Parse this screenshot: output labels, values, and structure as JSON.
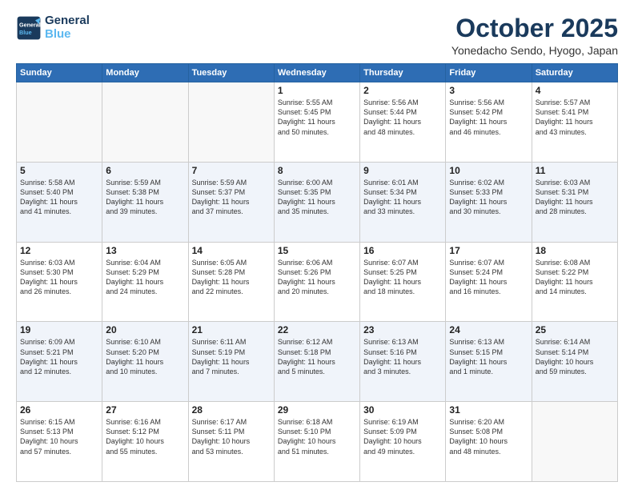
{
  "logo": {
    "line1": "General",
    "line2": "Blue"
  },
  "title": "October 2025",
  "subtitle": "Yonedacho Sendo, Hyogo, Japan",
  "weekdays": [
    "Sunday",
    "Monday",
    "Tuesday",
    "Wednesday",
    "Thursday",
    "Friday",
    "Saturday"
  ],
  "weeks": [
    [
      {
        "day": "",
        "info": ""
      },
      {
        "day": "",
        "info": ""
      },
      {
        "day": "",
        "info": ""
      },
      {
        "day": "1",
        "info": "Sunrise: 5:55 AM\nSunset: 5:45 PM\nDaylight: 11 hours\nand 50 minutes."
      },
      {
        "day": "2",
        "info": "Sunrise: 5:56 AM\nSunset: 5:44 PM\nDaylight: 11 hours\nand 48 minutes."
      },
      {
        "day": "3",
        "info": "Sunrise: 5:56 AM\nSunset: 5:42 PM\nDaylight: 11 hours\nand 46 minutes."
      },
      {
        "day": "4",
        "info": "Sunrise: 5:57 AM\nSunset: 5:41 PM\nDaylight: 11 hours\nand 43 minutes."
      }
    ],
    [
      {
        "day": "5",
        "info": "Sunrise: 5:58 AM\nSunset: 5:40 PM\nDaylight: 11 hours\nand 41 minutes."
      },
      {
        "day": "6",
        "info": "Sunrise: 5:59 AM\nSunset: 5:38 PM\nDaylight: 11 hours\nand 39 minutes."
      },
      {
        "day": "7",
        "info": "Sunrise: 5:59 AM\nSunset: 5:37 PM\nDaylight: 11 hours\nand 37 minutes."
      },
      {
        "day": "8",
        "info": "Sunrise: 6:00 AM\nSunset: 5:35 PM\nDaylight: 11 hours\nand 35 minutes."
      },
      {
        "day": "9",
        "info": "Sunrise: 6:01 AM\nSunset: 5:34 PM\nDaylight: 11 hours\nand 33 minutes."
      },
      {
        "day": "10",
        "info": "Sunrise: 6:02 AM\nSunset: 5:33 PM\nDaylight: 11 hours\nand 30 minutes."
      },
      {
        "day": "11",
        "info": "Sunrise: 6:03 AM\nSunset: 5:31 PM\nDaylight: 11 hours\nand 28 minutes."
      }
    ],
    [
      {
        "day": "12",
        "info": "Sunrise: 6:03 AM\nSunset: 5:30 PM\nDaylight: 11 hours\nand 26 minutes."
      },
      {
        "day": "13",
        "info": "Sunrise: 6:04 AM\nSunset: 5:29 PM\nDaylight: 11 hours\nand 24 minutes."
      },
      {
        "day": "14",
        "info": "Sunrise: 6:05 AM\nSunset: 5:28 PM\nDaylight: 11 hours\nand 22 minutes."
      },
      {
        "day": "15",
        "info": "Sunrise: 6:06 AM\nSunset: 5:26 PM\nDaylight: 11 hours\nand 20 minutes."
      },
      {
        "day": "16",
        "info": "Sunrise: 6:07 AM\nSunset: 5:25 PM\nDaylight: 11 hours\nand 18 minutes."
      },
      {
        "day": "17",
        "info": "Sunrise: 6:07 AM\nSunset: 5:24 PM\nDaylight: 11 hours\nand 16 minutes."
      },
      {
        "day": "18",
        "info": "Sunrise: 6:08 AM\nSunset: 5:22 PM\nDaylight: 11 hours\nand 14 minutes."
      }
    ],
    [
      {
        "day": "19",
        "info": "Sunrise: 6:09 AM\nSunset: 5:21 PM\nDaylight: 11 hours\nand 12 minutes."
      },
      {
        "day": "20",
        "info": "Sunrise: 6:10 AM\nSunset: 5:20 PM\nDaylight: 11 hours\nand 10 minutes."
      },
      {
        "day": "21",
        "info": "Sunrise: 6:11 AM\nSunset: 5:19 PM\nDaylight: 11 hours\nand 7 minutes."
      },
      {
        "day": "22",
        "info": "Sunrise: 6:12 AM\nSunset: 5:18 PM\nDaylight: 11 hours\nand 5 minutes."
      },
      {
        "day": "23",
        "info": "Sunrise: 6:13 AM\nSunset: 5:16 PM\nDaylight: 11 hours\nand 3 minutes."
      },
      {
        "day": "24",
        "info": "Sunrise: 6:13 AM\nSunset: 5:15 PM\nDaylight: 11 hours\nand 1 minute."
      },
      {
        "day": "25",
        "info": "Sunrise: 6:14 AM\nSunset: 5:14 PM\nDaylight: 10 hours\nand 59 minutes."
      }
    ],
    [
      {
        "day": "26",
        "info": "Sunrise: 6:15 AM\nSunset: 5:13 PM\nDaylight: 10 hours\nand 57 minutes."
      },
      {
        "day": "27",
        "info": "Sunrise: 6:16 AM\nSunset: 5:12 PM\nDaylight: 10 hours\nand 55 minutes."
      },
      {
        "day": "28",
        "info": "Sunrise: 6:17 AM\nSunset: 5:11 PM\nDaylight: 10 hours\nand 53 minutes."
      },
      {
        "day": "29",
        "info": "Sunrise: 6:18 AM\nSunset: 5:10 PM\nDaylight: 10 hours\nand 51 minutes."
      },
      {
        "day": "30",
        "info": "Sunrise: 6:19 AM\nSunset: 5:09 PM\nDaylight: 10 hours\nand 49 minutes."
      },
      {
        "day": "31",
        "info": "Sunrise: 6:20 AM\nSunset: 5:08 PM\nDaylight: 10 hours\nand 48 minutes."
      },
      {
        "day": "",
        "info": ""
      }
    ]
  ]
}
